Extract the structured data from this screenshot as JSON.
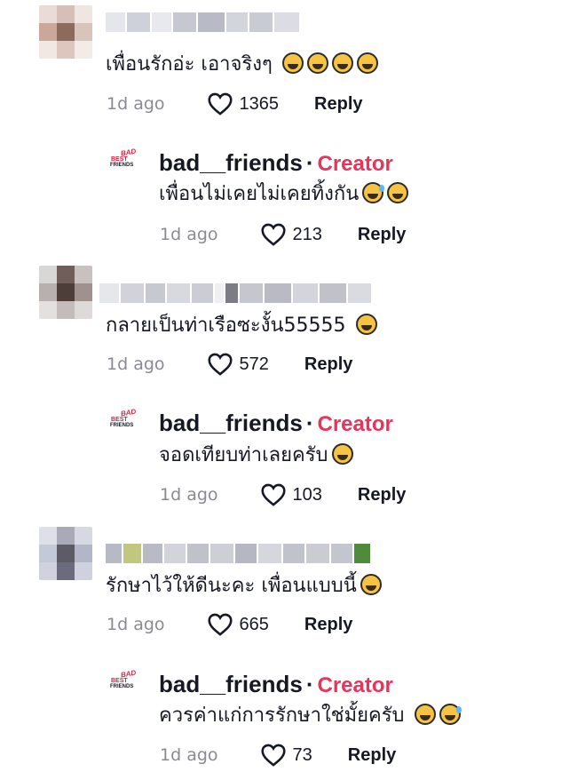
{
  "comments": [
    {
      "text": "เพื่อนรักอ่ะ เอาจริงๆ",
      "emoji_count": 4,
      "time": "1d ago",
      "likes": "1365",
      "reply": "Reply",
      "reply_item": {
        "author": "bad__friends",
        "separator": "·",
        "badge": "Creator",
        "text": "เพื่อนไม่เคยไม่เคยทิ้งกัน",
        "time": "1d ago",
        "likes": "213",
        "reply": "Reply"
      }
    },
    {
      "text": "กลายเป็นท่าเรือซะงั้น55555",
      "time": "1d ago",
      "likes": "572",
      "reply": "Reply",
      "reply_item": {
        "author": "bad__friends",
        "separator": "·",
        "badge": "Creator",
        "text": "จอดเทียบท่าเลยครับ",
        "time": "1d ago",
        "likes": "103",
        "reply": "Reply"
      }
    },
    {
      "text": "รักษาไว้ให้ดีนะคะ เพื่อนแบบนี้",
      "time": "1d ago",
      "likes": "665",
      "reply": "Reply",
      "reply_item": {
        "author": "bad__friends",
        "separator": "·",
        "badge": "Creator",
        "text": "ควรค่าแก่การรักษาใช่มั้ยครับ",
        "time": "1d ago",
        "likes": "73",
        "reply": "Reply"
      }
    }
  ],
  "logo": {
    "line1": "BAD",
    "line2": "BEST",
    "line3": "FRIENDS"
  },
  "colors": {
    "creator": "#e8345a",
    "time": "#8a8b91",
    "text": "#161823",
    "emoji": "#f6c343"
  },
  "icons": {
    "like": "heart-outline-icon",
    "emoji_laugh": "tears-of-joy-emoji",
    "emoji_sweat": "grinning-sweat-emoji"
  }
}
